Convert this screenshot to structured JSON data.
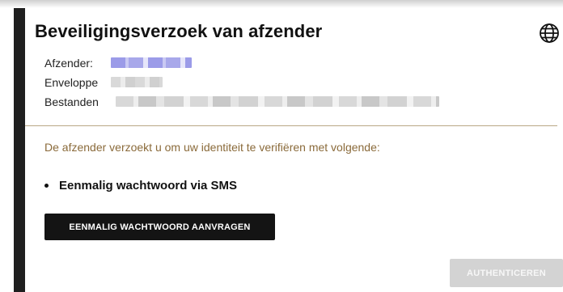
{
  "dialog": {
    "title": "Beveiligingsverzoek van afzender",
    "language_icon": "globe-icon"
  },
  "details": {
    "sender_label": "Afzender:",
    "envelope_label": "Enveloppe",
    "files_label": "Bestanden"
  },
  "verification": {
    "instruction": "De afzender verzoekt u om uw identiteit te verifiëren met volgende:",
    "methods": [
      {
        "label": "Eenmalig wachtwoord via SMS"
      }
    ]
  },
  "actions": {
    "request_label": "EENMALIG WACHTWOORD AANVRAGEN",
    "authenticate_label": "AUTHENTICEREN"
  },
  "colors": {
    "accent_text": "#8a6a3a",
    "divider": "#b9a786",
    "primary_button": "#141414",
    "disabled_button": "#d3d3d3"
  }
}
